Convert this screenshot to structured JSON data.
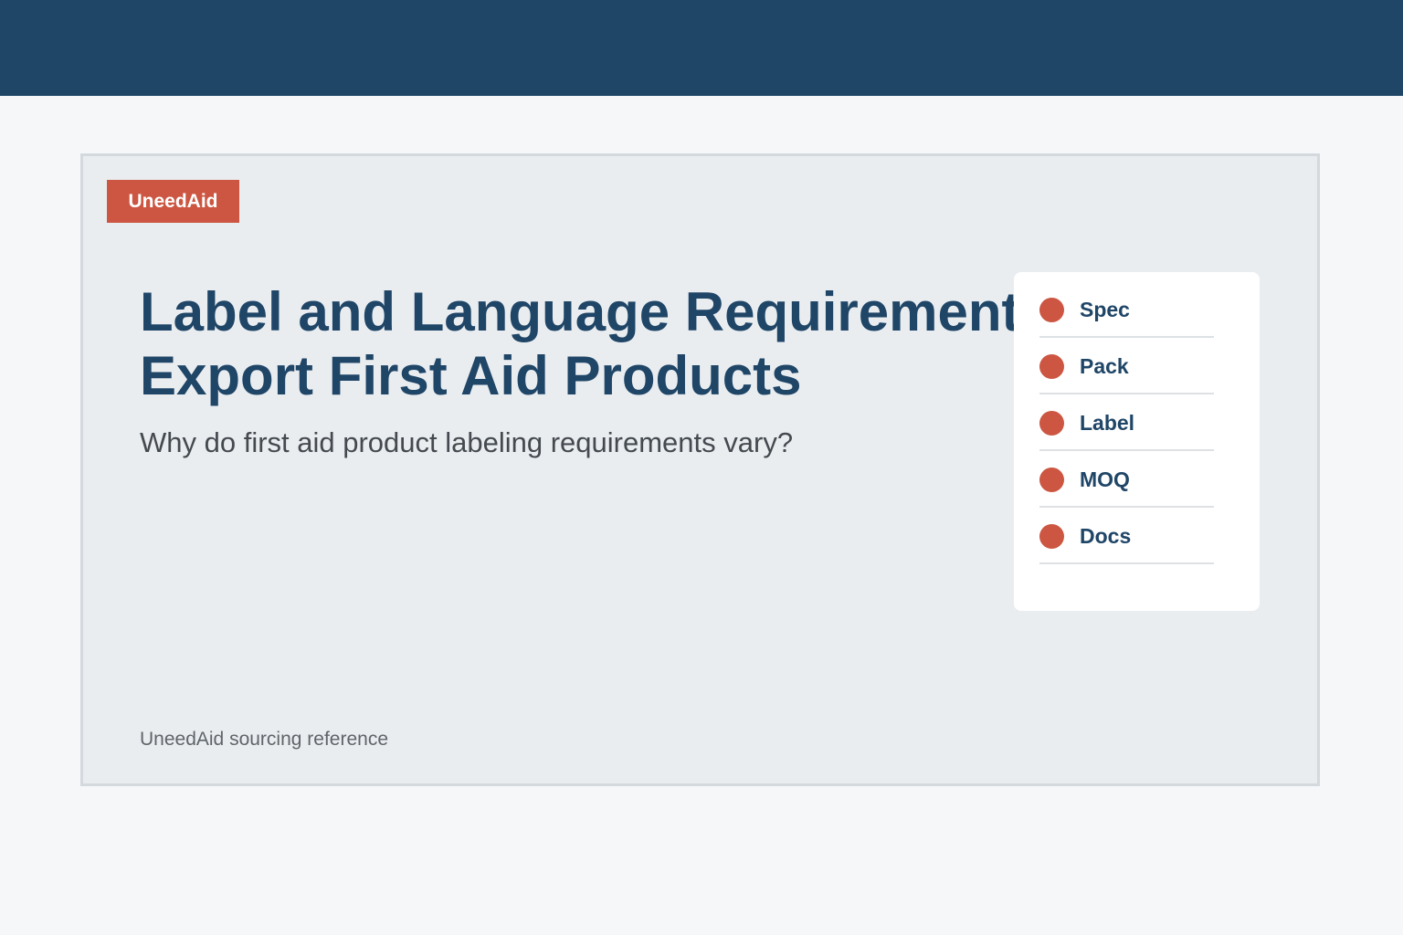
{
  "brand": {
    "badge_label": "UneedAid"
  },
  "hero": {
    "title_line1": "Label and Language Requirements",
    "title_line2": "Export First Aid Products",
    "subtitle": "Why do first aid product labeling requirements vary?"
  },
  "side_panel": {
    "items": [
      {
        "label": "Spec"
      },
      {
        "label": "Pack"
      },
      {
        "label": "Label"
      },
      {
        "label": "MOQ"
      },
      {
        "label": "Docs"
      }
    ]
  },
  "footer": {
    "note": "UneedAid sourcing reference"
  },
  "colors": {
    "header": "#1f4567",
    "accent": "#cc5641",
    "card_bg": "#eaedf0"
  }
}
